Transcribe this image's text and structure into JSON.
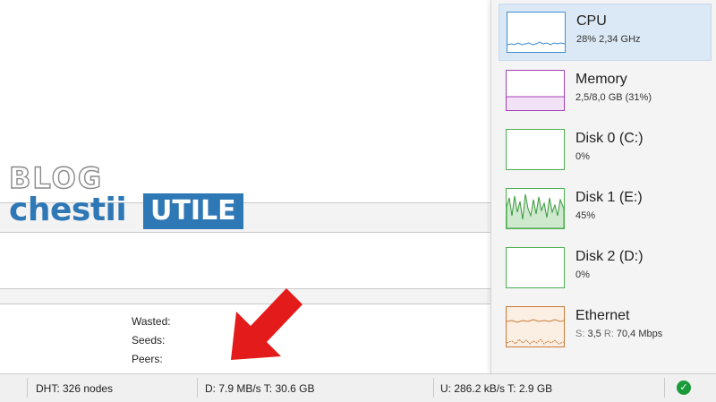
{
  "watermark": {
    "blog": "BLOG",
    "brand_left": "chestii",
    "brand_right": "UTILE"
  },
  "details": {
    "wasted_label": "Wasted:",
    "seeds_label": "Seeds:",
    "peers_label": "Peers:"
  },
  "status_bar": {
    "dht": "DHT: 326 nodes",
    "download": "D: 7.9 MB/s T: 30.6 GB",
    "upload": "U: 286.2 kB/s T: 2.9 GB",
    "status_icon": "check-circle-icon"
  },
  "performance": {
    "items": [
      {
        "id": "cpu",
        "title": "CPU",
        "subtitle": "28% 2,34 GHz",
        "color": "#3c8fd6",
        "selected": true
      },
      {
        "id": "memory",
        "title": "Memory",
        "subtitle": "2,5/8,0 GB (31%)",
        "color": "#a43fb8"
      },
      {
        "id": "disk0",
        "title": "Disk 0 (C:)",
        "subtitle": "0%",
        "color": "#4caf50"
      },
      {
        "id": "disk1",
        "title": "Disk 1 (E:)",
        "subtitle": "45%",
        "color": "#4caf50"
      },
      {
        "id": "disk2",
        "title": "Disk 2 (D:)",
        "subtitle": "0%",
        "color": "#4caf50"
      },
      {
        "id": "ethernet",
        "title": "Ethernet",
        "sub_s_label": "S:",
        "sub_s": "3,5",
        "sub_r_label": "R:",
        "sub_r": "70,4 Mbps",
        "color": "#c87a36"
      }
    ]
  },
  "annotation": {
    "arrow_color": "#e41b1b"
  }
}
